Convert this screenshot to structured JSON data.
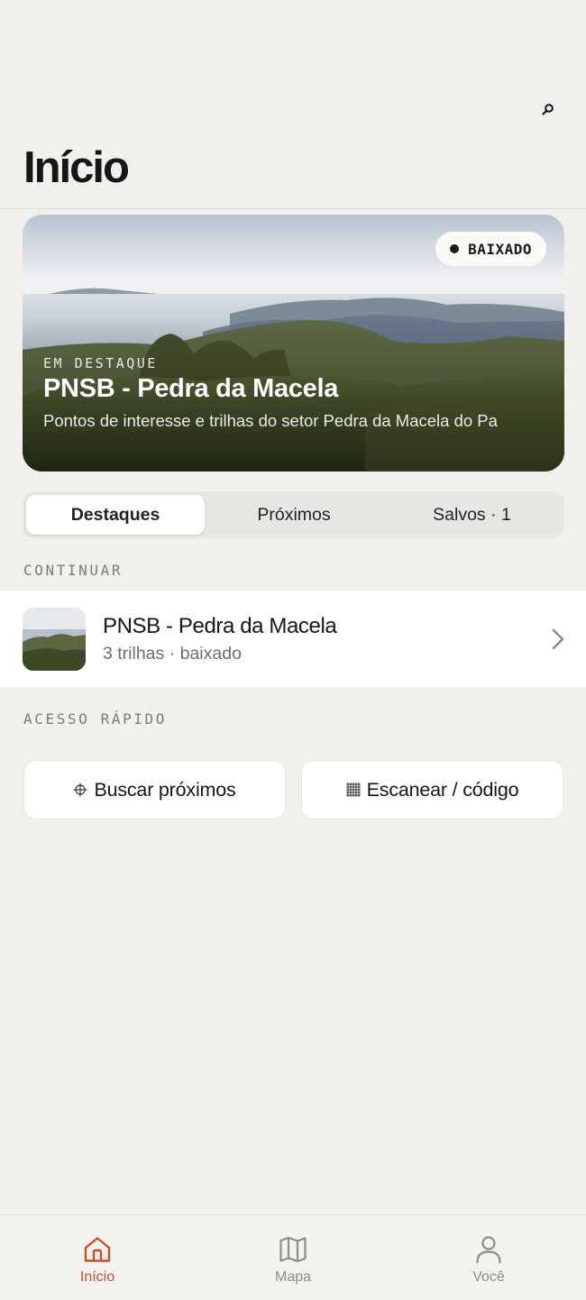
{
  "header": {
    "title": "Início",
    "search_icon": "search-icon"
  },
  "featured": {
    "badge": "BAIXADO",
    "eyebrow": "EM DESTAQUE",
    "title": "PNSB - Pedra da Macela",
    "subtitle": "Pontos de interesse e trilhas do setor Pedra da Macela do Pa"
  },
  "tabs": [
    {
      "label": "Destaques",
      "active": true
    },
    {
      "label": "Próximos",
      "active": false
    },
    {
      "label": "Salvos · 1",
      "active": false
    }
  ],
  "continue_section": {
    "label": "CONTINUAR",
    "item": {
      "title": "PNSB - Pedra da Macela",
      "subtitle": "3 trilhas · baixado"
    }
  },
  "quick_access": {
    "label": "ACESSO RÁPIDO",
    "buttons": [
      {
        "label": "Buscar próximos",
        "icon": "crosshair-icon"
      },
      {
        "label": "Escanear / código",
        "icon": "grid-code-icon"
      }
    ]
  },
  "bottom_nav": [
    {
      "label": "Início",
      "icon": "home-icon",
      "active": true
    },
    {
      "label": "Mapa",
      "icon": "map-icon",
      "active": false
    },
    {
      "label": "Você",
      "icon": "user-icon",
      "active": false
    }
  ],
  "colors": {
    "accent": "#c4502a",
    "background": "#f1f0ed"
  }
}
